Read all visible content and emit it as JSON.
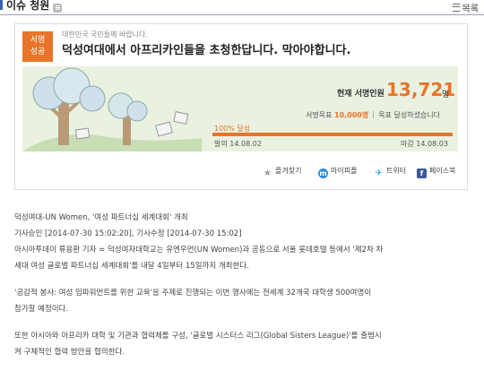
{
  "header": {
    "title": "이슈 청원",
    "list_label": "목록"
  },
  "petition": {
    "badge_line1": "서명",
    "badge_line2": "성공",
    "kicker": "대한민국 국민들께 바랍니다.",
    "title": "덕성여대에서 아프리카인들을 초청한답니다. 막아야합니다.",
    "count_label": "현재 서명인원",
    "count": "13,721",
    "count_unit": "명",
    "goal_label": "서명목표",
    "goal_value": "10,000명",
    "goal_status": "목표 달성하셨습니다",
    "progress_label": "100% 달성",
    "progress_fraction": 1.0,
    "start_label": "발의",
    "start_date": "14.08.02",
    "end_label": "마감",
    "end_date": "14.08.03"
  },
  "actions": {
    "bookmark": "즐겨찾기",
    "mypeople": "마이피플",
    "twitter": "트위터",
    "facebook": "페이스북"
  },
  "article": {
    "lines": [
      "덕성여대-UN Women, '여성 파트너십 세계대회' 개최",
      "기사승인 [2014-07-30 15:02:20], 기사수정 [2014-07-30 15:02]",
      "아시아투데이 류용환 기자 = 덕성여자대학교는 유엔우먼(UN Women)과 공동으로 서울 롯데호텔 등에서 '제2차 차",
      "세대 여성 글로벌 파트너십 세계대회'를 내달 4일부터 15일까지 개최한다."
    ],
    "para2": [
      "'공감적 봉사: 여성 임파워먼트를 위한 교육'을 주제로 진행되는 이번 행사에는 전세계 32개국 대학생 500여명이",
      "참가할 예정이다."
    ],
    "para3": [
      "또한 아시아와 아프리카 대학 및 기관과 협력체를 구성, '글로벌 시스터스 리그(Global Sisters League)'를 출범시",
      "켜 구체적인 협력 방안을 협의한다."
    ]
  },
  "colors": {
    "accent": "#e8742a",
    "banner_bg": "#e9f1e0",
    "brand_bar": "#3a5fb0"
  },
  "icons": {
    "bookmark": "star-icon",
    "mypeople": "mypeople-icon",
    "twitter": "twitter-bird-icon",
    "facebook": "facebook-icon",
    "list": "list-icon",
    "feed": "rss-icon"
  }
}
